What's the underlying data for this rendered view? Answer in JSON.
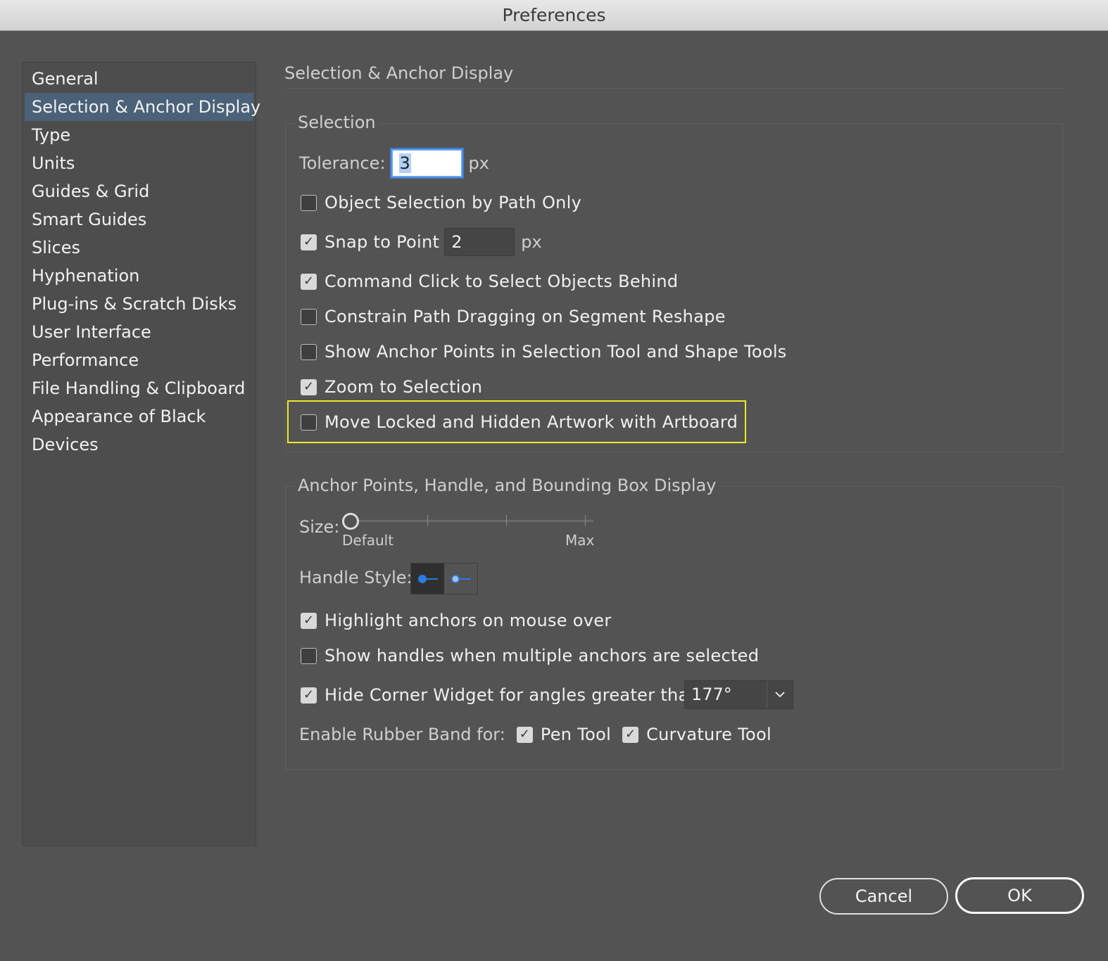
{
  "window": {
    "title": "Preferences"
  },
  "sidebar": {
    "items": [
      {
        "label": "General"
      },
      {
        "label": "Selection & Anchor Display",
        "selected": true
      },
      {
        "label": "Type"
      },
      {
        "label": "Units"
      },
      {
        "label": "Guides & Grid"
      },
      {
        "label": "Smart Guides"
      },
      {
        "label": "Slices"
      },
      {
        "label": "Hyphenation"
      },
      {
        "label": "Plug-ins & Scratch Disks"
      },
      {
        "label": "User Interface"
      },
      {
        "label": "Performance"
      },
      {
        "label": "File Handling & Clipboard"
      },
      {
        "label": "Appearance of Black"
      },
      {
        "label": "Devices"
      }
    ]
  },
  "panel": {
    "title": "Selection & Anchor Display"
  },
  "selection": {
    "legend": "Selection",
    "tolerance_label": "Tolerance:",
    "tolerance_value": "3",
    "tolerance_unit": "px",
    "object_selection_by_path": {
      "label": "Object Selection by Path Only",
      "checked": false
    },
    "snap_to_point": {
      "label": "Snap to Point",
      "checked": true,
      "value": "2",
      "unit": "px"
    },
    "command_click": {
      "label": "Command Click to Select Objects Behind",
      "checked": true
    },
    "constrain_path": {
      "label": "Constrain Path Dragging on Segment Reshape",
      "checked": false
    },
    "show_anchor_points": {
      "label": "Show Anchor Points in Selection Tool and Shape Tools",
      "checked": false
    },
    "zoom_to_selection": {
      "label": "Zoom to Selection",
      "checked": true
    },
    "move_locked": {
      "label": "Move Locked and Hidden Artwork with Artboard",
      "checked": false
    }
  },
  "anchor": {
    "legend": "Anchor Points, Handle, and Bounding Box Display",
    "size_label": "Size:",
    "size_min_label": "Default",
    "size_max_label": "Max",
    "size_level": 0,
    "handle_style_label": "Handle Style:",
    "handle_style_selected": "solid",
    "highlight_anchors": {
      "label": "Highlight anchors on mouse over",
      "checked": true
    },
    "show_handles": {
      "label": "Show handles when multiple anchors are selected",
      "checked": false
    },
    "hide_corner_widget": {
      "label": "Hide Corner Widget for angles greater than:",
      "checked": true,
      "value": "177°"
    },
    "rubber_band_label": "Enable Rubber Band for:",
    "pen_tool": {
      "label": "Pen Tool",
      "checked": true
    },
    "curvature_tool": {
      "label": "Curvature Tool",
      "checked": true
    }
  },
  "buttons": {
    "cancel": "Cancel",
    "ok": "OK"
  },
  "colors": {
    "background": "#535353",
    "selected_item": "#4a6178",
    "highlight_outline": "#eaea2a",
    "accent": "#2b7be0"
  },
  "icons": {
    "checkmark": "check-icon",
    "dropdown": "chevron-down-icon"
  }
}
